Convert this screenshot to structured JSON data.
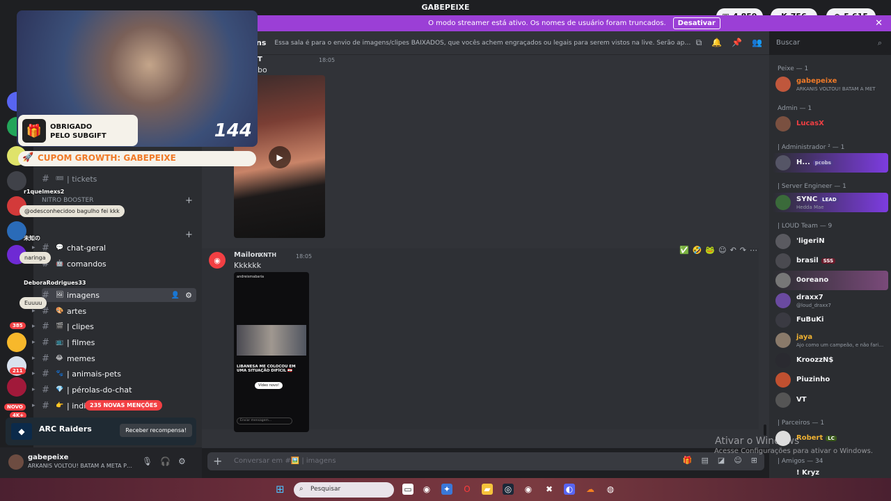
{
  "window": {
    "title": "GABEPEIXE"
  },
  "counters": [
    {
      "icon": "twitch-icon",
      "value": "4.859"
    },
    {
      "icon": "kick-icon",
      "value": "756"
    },
    {
      "icon": "globe-icon",
      "value": "5.615"
    }
  ],
  "banner": {
    "text": "O modo streamer está ativo. Os nomes de usuário foram truncados.",
    "button": "Desativar"
  },
  "header": {
    "channel_name": "ns",
    "topic": "Essa sala é para o envio de imagens/clipes BAIXADOS, que vocês achem engraçados ou legais para serem vistos na live. Serão apagados prints de o...",
    "search_placeholder": "Buscar"
  },
  "sidebar": {
    "channels": [
      {
        "name": "| tickets"
      },
      {
        "name": "NITRO BOOSTER"
      },
      {
        "name": "chat-geral"
      },
      {
        "name": "comandos"
      },
      {
        "name": "imagens"
      },
      {
        "name": "artes"
      },
      {
        "name": "| clipes"
      },
      {
        "name": "| filmes"
      },
      {
        "name": "memes"
      },
      {
        "name": "| animais-pets"
      },
      {
        "name": "| pérolas-do-chat"
      },
      {
        "name": "| indic"
      }
    ],
    "mentions_badge": "235 NOVAS MENÇÕES",
    "server_badges": [
      "385",
      "211",
      "NOVO",
      "4K+"
    ]
  },
  "promo": {
    "name": "ARC Raiders",
    "button": "Receber recompensa!"
  },
  "user": {
    "name": "gabepeixe",
    "status": "ARKANIS VOLTOU! BATAM A META PE..."
  },
  "messages": [
    {
      "author_fragment": "T",
      "time": "18:05",
      "text_fragment": "bo"
    },
    {
      "author": "Mailon",
      "tag": "XNTH",
      "time": "18:05",
      "text": "Kkkkkk"
    }
  ],
  "embed_phone": {
    "account": "andreismabaria",
    "caption": "LIBANESA ME COLOCOU EM UMA SITUAÇÃO DIFÍCIL 🇱🇧",
    "button": "Vídeo novo!",
    "compose": "Enviar mensagem..."
  },
  "composer": {
    "placeholder": "Conversar em #🖼️ | imagens"
  },
  "members": {
    "roles": [
      {
        "label": "Peixe — 1"
      },
      {
        "label": "Admin — 1"
      },
      {
        "label": "| Administrador ² — 1"
      },
      {
        "label": "| Server Engineer — 1"
      },
      {
        "label": "| LOUD Team — 9"
      },
      {
        "label": "| Parceiros — 1"
      },
      {
        "label": "| Amigos — 34"
      }
    ],
    "list": [
      {
        "name": "gabepeixe",
        "sub": "ARKANIS VOLTOU! BATAM A MET",
        "color": "#f07a28"
      },
      {
        "name": "LucasX",
        "sub": "",
        "color": "#f23f43"
      },
      {
        "name": "H...",
        "tag": "𝕡𝕔𝕠𝕓𝕤",
        "sub": "",
        "color": "#f2f3f5"
      },
      {
        "name": "SYNC",
        "tag": "LEAD",
        "sub": "Hedda Mae",
        "color": "#f2f3f5"
      },
      {
        "name": "'ligeriN",
        "sub": "",
        "color": "#f2f3f5"
      },
      {
        "name": "brasil",
        "tag": "SSS",
        "sub": "",
        "color": "#f2f3f5"
      },
      {
        "name": "0oreano",
        "sub": "",
        "color": "#f2f3f5"
      },
      {
        "name": "draxx7",
        "sub": "@loud_draxx7",
        "color": "#f2f3f5"
      },
      {
        "name": "FuBuKi",
        "sub": "",
        "color": "#f2f3f5"
      },
      {
        "name": "jaya",
        "sub": "Ajo como um campeão, e não faria...",
        "color": "#f2f3f5"
      },
      {
        "name": "KroozzN$",
        "sub": "",
        "color": "#f2f3f5"
      },
      {
        "name": "Piuzinho",
        "sub": "",
        "color": "#f2f3f5"
      },
      {
        "name": "VT",
        "sub": "",
        "color": "#f2f3f5"
      },
      {
        "name": "Robert",
        "tag": "LC",
        "sub": "",
        "color": "#f0b232"
      },
      {
        "name": "! Kryz",
        "sub": "",
        "color": "#f2f3f5"
      }
    ]
  },
  "watermark": {
    "title": "Ativar o Windows",
    "sub": "Acesse Configurações para ativar o Windows."
  },
  "overlay": {
    "sub_count": "144",
    "subgift_line1": "OBRIGADO",
    "subgift_line2": "PELO SUBGIFT",
    "coupon": "CUPOM GROWTH: GABEPEIXE",
    "chat": [
      {
        "user": "r1quelmexs2",
        "text": ""
      },
      {
        "user": "",
        "text": "@odesconhecidoo bagulho fei kkk"
      },
      {
        "user": "未知の",
        "text": ""
      },
      {
        "user": "",
        "text": "naringa"
      },
      {
        "user": "DeboraRodrigues33",
        "text": ""
      },
      {
        "user": "",
        "text": "Euuuu"
      }
    ]
  },
  "taskbar": {
    "search_placeholder": "Pesquisar"
  }
}
